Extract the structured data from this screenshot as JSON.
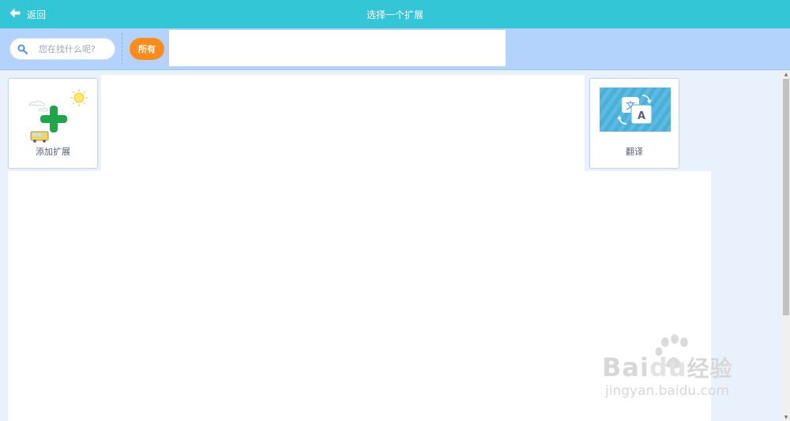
{
  "header": {
    "back_label": "返回",
    "title": "选择一个扩展",
    "background": "#33c6d6"
  },
  "filter_bar": {
    "search_placeholder": "您在找什么呢?",
    "search_value": "",
    "tag_all": "所有",
    "tag_color": "#ff8c1a"
  },
  "extensions": [
    {
      "label": "添加扩展",
      "icon": "add-extension-icon"
    },
    {
      "label": "翻译",
      "icon": "translate-icon"
    }
  ],
  "watermark": {
    "brand": "Bai",
    "brand_tail": "du",
    "product": "经验",
    "url": "jingyan.baidu.com"
  }
}
